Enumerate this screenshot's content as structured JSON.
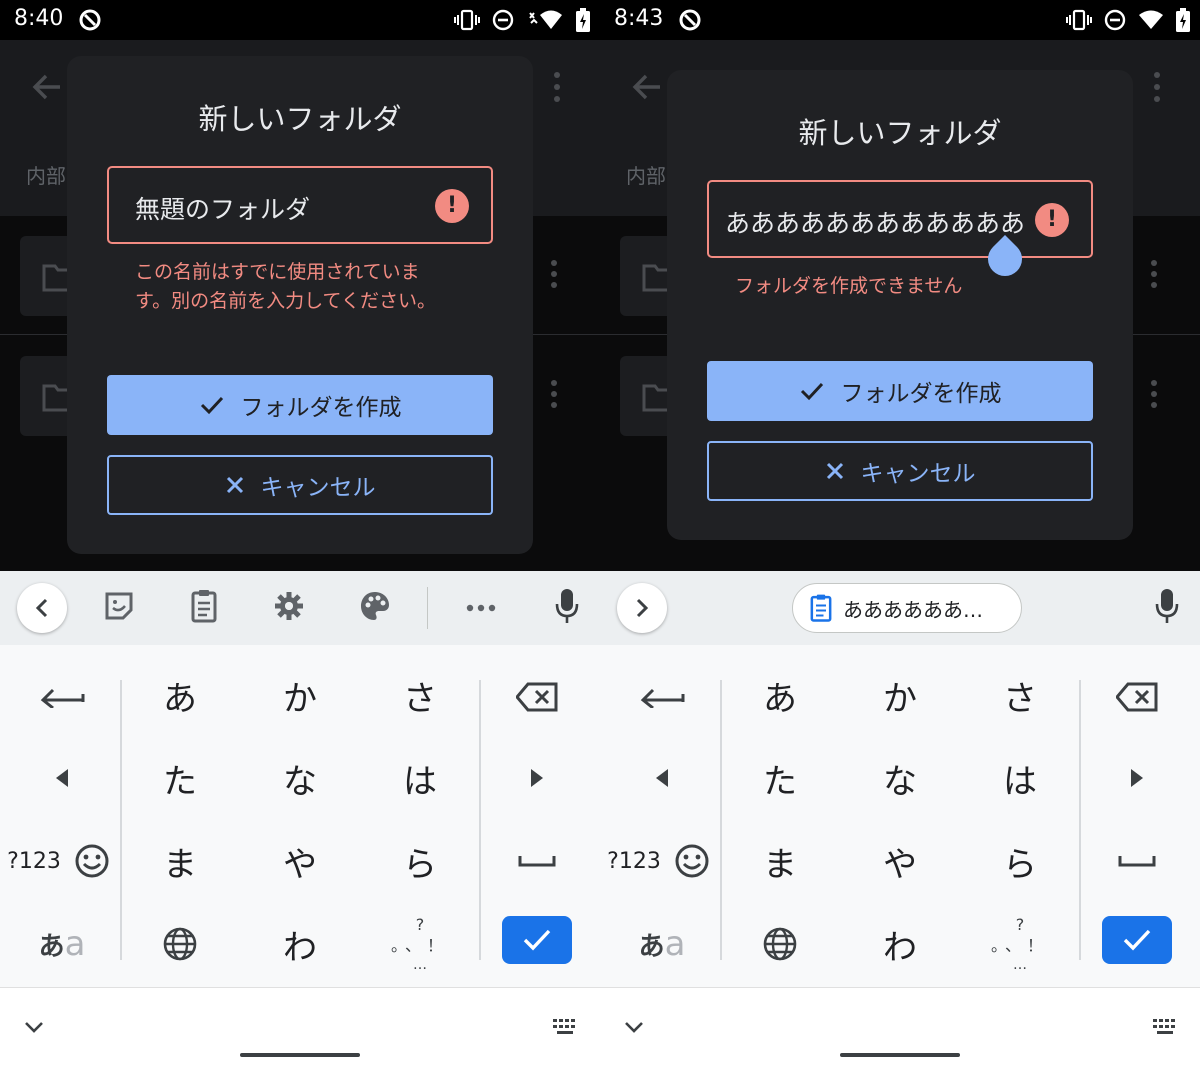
{
  "left": {
    "status": {
      "time": "8:40"
    },
    "background": {
      "breadcrumb": "内部"
    },
    "dialog": {
      "title": "新しいフォルダ",
      "field_value": "無題のフォルダ",
      "error_line1": "この名前はすでに使用されていま",
      "error_line2": "す。別の名前を入力してください。",
      "create_label": "フォルダを作成",
      "cancel_label": "キャンセル"
    }
  },
  "right": {
    "status": {
      "time": "8:43"
    },
    "background": {
      "breadcrumb": "内部"
    },
    "dialog": {
      "title": "新しいフォルダ",
      "field_value": "ああああああああああああ",
      "error_line1": "フォルダを作成できません",
      "create_label": "フォルダを作成",
      "cancel_label": "キャンセル"
    },
    "clipboard_chip": "ああああああ…"
  },
  "keyboard": {
    "row1": [
      "あ",
      "か",
      "さ"
    ],
    "row2": [
      "た",
      "な",
      "は"
    ],
    "row3": [
      "ま",
      "や",
      "ら"
    ],
    "row4_mid": "わ",
    "num_label": "?123",
    "mode_label_a": "あ",
    "mode_label_b": "a",
    "punct_top": "?",
    "punct_mid": "。、！",
    "punct_bottom": "…"
  },
  "icons": {
    "status": [
      "signal-app-icon",
      "vibrate-icon",
      "dnd-icon",
      "wifi-icon",
      "battery-icon"
    ],
    "toolbar_left": [
      "collapse-chevron-icon",
      "sticker-icon",
      "clipboard-icon",
      "gear-icon",
      "palette-icon",
      "more-icon",
      "mic-icon"
    ],
    "toolbar_right": [
      "expand-chevron-icon",
      "clipboard-icon",
      "mic-icon"
    ]
  },
  "colors": {
    "dialog_bg": "#202124",
    "error": "#f28b82",
    "accent": "#8ab4f8",
    "enter_key": "#1a73e8"
  }
}
